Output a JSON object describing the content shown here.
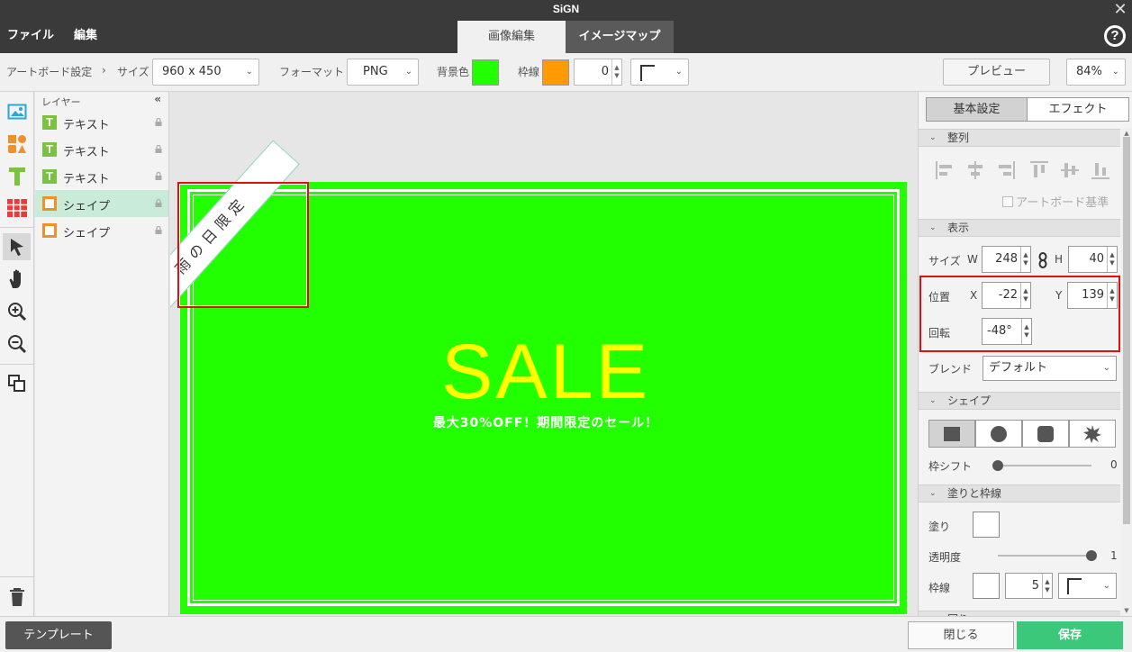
{
  "app": {
    "title": "SiGN",
    "close_glyph": "✕"
  },
  "menu": {
    "file": "ファイル",
    "edit": "編集"
  },
  "mode_tabs": {
    "image_edit": "画像編集",
    "image_map": "イメージマップ"
  },
  "help": {
    "glyph": "?",
    "icon": "help-circle-icon"
  },
  "toolbar": {
    "artboard_settings": "アートボード設定",
    "breadcrumb_sep": "›",
    "size_label": "サイズ",
    "size_value": "960 x 450",
    "format_label": "フォーマット",
    "format_value": "PNG",
    "bg_label": "背景色",
    "bg_color": "#22ff00",
    "border_label": "枠線",
    "border_color": "#ff9a00",
    "border_width": "0",
    "preview_label": "プレビュー",
    "zoom_value": "84%"
  },
  "layers": {
    "header": "レイヤー",
    "collapse_glyph": "«",
    "items": [
      {
        "type": "text",
        "type_glyph": "T",
        "label": "テキスト"
      },
      {
        "type": "text",
        "type_glyph": "T",
        "label": "テキスト"
      },
      {
        "type": "text",
        "type_glyph": "T",
        "label": "テキスト"
      },
      {
        "type": "shape",
        "type_glyph": "",
        "label": "シェイプ",
        "selected": true
      },
      {
        "type": "shape",
        "type_glyph": "",
        "label": "シェイプ"
      }
    ]
  },
  "tools": [
    "image-tool-icon",
    "shapes-tool-icon",
    "text-tool-icon",
    "table-tool-icon",
    "select-arrow-icon",
    "hand-icon",
    "zoom-in-icon",
    "zoom-out-icon",
    "arrange-icon",
    "trash-icon"
  ],
  "canvas": {
    "background": "#22ff00",
    "sale_text": "SALE",
    "sale_color": "#ffff00",
    "subtitle": "最大30%OFF！期間限定のセール！",
    "ribbon_text": "雨の日限定"
  },
  "props": {
    "tabs": {
      "basic": "基本設定",
      "effect": "エフェクト"
    },
    "sections": {
      "align": "整列",
      "display": "表示",
      "shape": "シェイプ",
      "fill_stroke": "塗りと枠線",
      "next_partial": "回り"
    },
    "caret": "⌄",
    "artboard_basis": "アートボード基準",
    "size_label": "サイズ",
    "w_label": "W",
    "w_value": "248",
    "h_label": "H",
    "h_value": "40",
    "position_label": "位置",
    "x_label": "X",
    "x_value": "-22",
    "y_label": "Y",
    "y_value": "139",
    "rotation_label": "回転",
    "rotation_value": "-48°",
    "blend_label": "ブレンド",
    "blend_value": "デフォルト",
    "shape_shift_label": "枠シフト",
    "shape_shift_value": "0",
    "fill_label": "塗り",
    "fill_color": "#ffffff",
    "opacity_label": "透明度",
    "opacity_value": "1",
    "stroke_label": "枠線",
    "stroke_color": "#ffffff",
    "stroke_width": "5"
  },
  "bottom": {
    "template": "テンプレート",
    "close": "閉じる",
    "save": "保存"
  }
}
